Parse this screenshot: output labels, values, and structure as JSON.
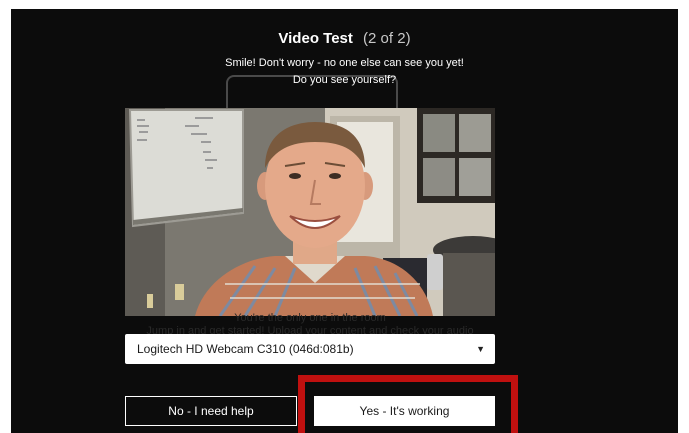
{
  "dialog": {
    "title": "Video Test",
    "step": "(2 of 2)",
    "subtitle_line1": "Smile! Don't worry - no one else can see you yet!",
    "subtitle_line2": "Do you see yourself?",
    "ghost_line1": "You're the only one in the room",
    "ghost_line2": "Jump in and get started! Upload your content and check your audio"
  },
  "camera": {
    "selected": "Logitech HD Webcam C310 (046d:081b)"
  },
  "buttons": {
    "no_label": "No - I need help",
    "yes_label": "Yes - It's working"
  },
  "colors": {
    "dialog_bg": "#0c0c0c",
    "highlight": "#c0100f",
    "button_yes_bg": "#ffffff",
    "button_no_border": "#ffffff"
  },
  "icons": {
    "dropdown": "caret-down-icon"
  }
}
